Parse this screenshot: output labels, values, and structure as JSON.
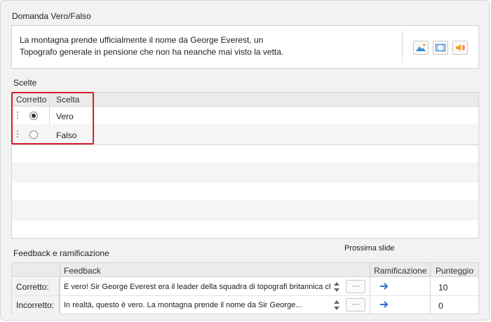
{
  "question": {
    "section_title": "Domanda Vero/Falso",
    "text_line1": "La montagna prende ufficialmente il nome da George Everest, un",
    "text_line2": "Topografo generale in pensione che non ha neanche mai visto la vetta.",
    "media_buttons": [
      "image-icon",
      "video-icon",
      "audio-icon"
    ]
  },
  "choices": {
    "section_title": "Scelte",
    "headers": {
      "correct": "Corretto",
      "choice": "Scelta"
    },
    "rows": [
      {
        "label": "Vero",
        "selected": true
      },
      {
        "label": "Falso",
        "selected": false
      }
    ],
    "highlight_color": "#d0202a"
  },
  "feedback": {
    "section_title": "Feedback e ramificazione",
    "next_slide_label": "Prossima slide",
    "headers": {
      "feedback": "Feedback",
      "branching": "Ramificazione",
      "score": "Punteggio"
    },
    "rows": [
      {
        "label": "Corretto:",
        "text": "È vero! Sir George Everest era il leader della squadra di topografi britannica che",
        "ellipsis": "···",
        "score": "10"
      },
      {
        "label": "Incorretto:",
        "text": "In realtà, questo è vero. La montagna prende il nome da Sir George...",
        "ellipsis": "···",
        "score": "0"
      }
    ],
    "arrow_color": "#2a73c9"
  }
}
